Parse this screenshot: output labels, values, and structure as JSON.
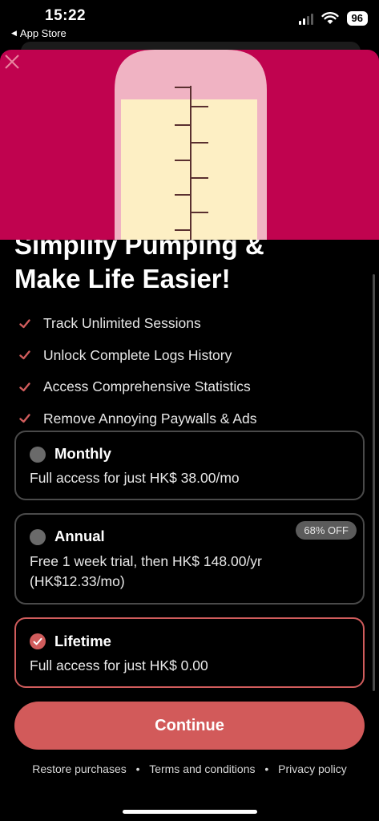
{
  "status_bar": {
    "time": "15:22",
    "back_label": "App Store",
    "battery": "96"
  },
  "headline": {
    "line1": "Simplify Pumping &",
    "line2": "Make Life Easier!"
  },
  "features": [
    "Track Unlimited Sessions",
    "Unlock Complete Logs History",
    "Access Comprehensive Statistics",
    "Remove Annoying Paywalls & Ads"
  ],
  "plans": {
    "monthly": {
      "name": "Monthly",
      "desc": "Full access for just HK$ 38.00/mo",
      "selected": false
    },
    "annual": {
      "name": "Annual",
      "desc_line1": "Free 1 week trial, then HK$ 148.00/yr",
      "desc_line2": "(HK$12.33/mo)",
      "badge": "68% OFF",
      "selected": false
    },
    "lifetime": {
      "name": "Lifetime",
      "desc": "Full access for just HK$ 0.00",
      "selected": true
    }
  },
  "continue_label": "Continue",
  "footer": {
    "restore": "Restore purchases",
    "terms": "Terms and conditions",
    "privacy": "Privacy policy",
    "separator": "•"
  },
  "colors": {
    "hero_bg": "#c0034f",
    "accent": "#d25a5a",
    "card_border": "#4a4a4a"
  },
  "icons": {
    "close": "close-icon",
    "check": "check-icon",
    "radio_checked": "checkmark-circle-icon"
  }
}
